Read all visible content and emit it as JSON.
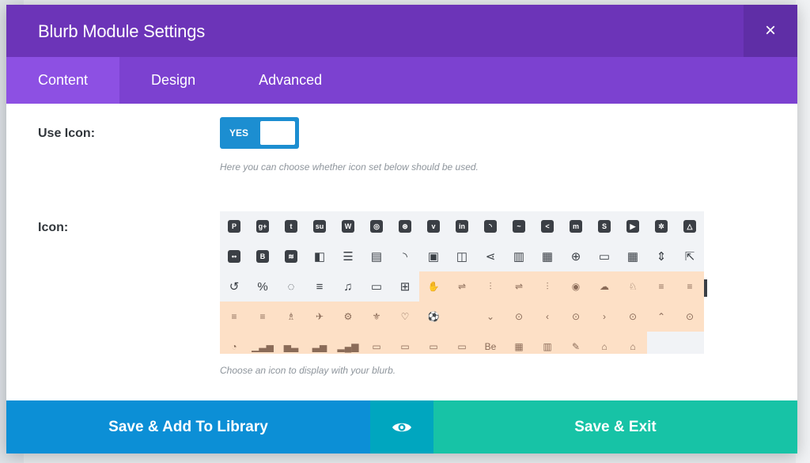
{
  "modal": {
    "title": "Blurb Module Settings",
    "close_glyph": "×",
    "tabs": [
      {
        "label": "Content",
        "active": true
      },
      {
        "label": "Design",
        "active": false
      },
      {
        "label": "Advanced",
        "active": false
      }
    ]
  },
  "use_icon": {
    "label": "Use Icon:",
    "toggle_text": "YES",
    "toggle_on": true,
    "description": "Here you can choose whether icon set below should be used."
  },
  "icon": {
    "label": "Icon:",
    "description": "Choose an icon to display with your blurb.",
    "rows": [
      [
        "pinterest-icon",
        "google-plus-icon",
        "tumblr-icon",
        "stumbleupon-icon",
        "wordpress-icon",
        "instagram-icon",
        "dribbble-icon",
        "vimeo-icon",
        "linkedin-icon",
        "rss-icon",
        "deviantart-icon",
        "share-icon",
        "myspace-icon",
        "skype-icon",
        "youtube-icon",
        "picassa-icon",
        "google-drive-icon"
      ],
      [
        "flickr-icon",
        "blogger-icon",
        "spotify-icon",
        "delicious-icon",
        "list-icon",
        "news-icon",
        "feed-icon",
        "gallery-icon",
        "columns-icon",
        "share-alt-icon",
        "book-icon",
        "table-icon",
        "hash-icon",
        "browser-icon",
        "grid-icon",
        "resize-icon",
        "cursor-icon"
      ],
      [
        "history-icon",
        "percent-icon",
        "chat-icon",
        "align-left-icon",
        "music-icon",
        "laptop-icon",
        "gift-icon",
        "hand-icon",
        "sliders-icon",
        "sliders-alt-icon",
        "equalizer-icon",
        "sliders-v-icon",
        "equalizer-v-icon",
        "cloud-icon",
        "bell-icon",
        "bug-icon",
        "align-center-icon"
      ],
      [
        "align-left-alt-icon",
        "align-right-icon",
        "stamp-icon",
        "plane-icon",
        "chip-icon",
        "badge-icon",
        "heart-icon",
        "basketball-icon",
        "apple-icon",
        "chevron-down-icon",
        "circle-chevron-down-icon",
        "chevron-left-icon",
        "circle-chevron-left-icon",
        "chevron-right-icon",
        "circle-chevron-right-icon",
        "chevron-up-icon",
        "circle-chevron-up-icon"
      ],
      [
        "pie-icon",
        "bar-chart-icon",
        "bar-chart-alt-icon",
        "bar-chart-down-icon",
        "bar-chart-up-icon",
        "battery-full-icon",
        "battery-mid-icon",
        "battery-low-icon",
        "battery-empty-icon",
        "behance-icon",
        "calendar-icon",
        "building-icon",
        "pen-icon",
        "shop-icon",
        "bank-icon"
      ]
    ],
    "glyphs": {
      "pinterest-icon": "P",
      "google-plus-icon": "g+",
      "tumblr-icon": "t",
      "stumbleupon-icon": "su",
      "wordpress-icon": "W",
      "instagram-icon": "◎",
      "dribbble-icon": "⊛",
      "vimeo-icon": "v",
      "linkedin-icon": "in",
      "rss-icon": "◝",
      "deviantart-icon": "~",
      "share-icon": "<",
      "myspace-icon": "m",
      "skype-icon": "S",
      "youtube-icon": "▶",
      "picassa-icon": "✲",
      "google-drive-icon": "△",
      "flickr-icon": "••",
      "blogger-icon": "B",
      "spotify-icon": "≋",
      "delicious-icon": "◧",
      "list-icon": "☰",
      "news-icon": "▤",
      "feed-icon": "◝",
      "gallery-icon": "▣",
      "columns-icon": "◫",
      "share-alt-icon": "⋖",
      "book-icon": "▥",
      "table-icon": "▦",
      "hash-icon": "⊕",
      "browser-icon": "▭",
      "grid-icon": "▦",
      "resize-icon": "⇕",
      "cursor-icon": "⇱",
      "history-icon": "↺",
      "percent-icon": "%",
      "chat-icon": "◌",
      "align-left-icon": "≡",
      "music-icon": "♫",
      "laptop-icon": "▭",
      "gift-icon": "⊞",
      "hand-icon": "✋",
      "sliders-icon": "⇌",
      "sliders-alt-icon": "⫶",
      "equalizer-icon": "⇌",
      "sliders-v-icon": "⫶",
      "equalizer-v-icon": "◉",
      "cloud-icon": "☁",
      "bell-icon": "♘",
      "bug-icon": "≡",
      "align-center-icon": "≡",
      "align-left-alt-icon": "≡",
      "align-right-icon": "≡",
      "stamp-icon": "♗",
      "plane-icon": "✈",
      "chip-icon": "⚙",
      "badge-icon": "⚜",
      "heart-icon": "♡",
      "basketball-icon": "⚽",
      "apple-icon": "",
      "chevron-down-icon": "⌄",
      "circle-chevron-down-icon": "⊙",
      "chevron-left-icon": "‹",
      "circle-chevron-left-icon": "⊙",
      "chevron-right-icon": "›",
      "circle-chevron-right-icon": "⊙",
      "chevron-up-icon": "⌃",
      "circle-chevron-up-icon": "⊙",
      "pie-icon": "◔",
      "bar-chart-icon": "▁▃▅",
      "bar-chart-alt-icon": "▅▃",
      "bar-chart-down-icon": "▃▅",
      "bar-chart-up-icon": "▂▄▆",
      "battery-full-icon": "▭",
      "battery-mid-icon": "▭",
      "battery-low-icon": "▭",
      "battery-empty-icon": "▭",
      "behance-icon": "Be",
      "calendar-icon": "▦",
      "building-icon": "▥",
      "pen-icon": "✎",
      "shop-icon": "⌂",
      "bank-icon": "⌂"
    },
    "highlighted_start": {
      "row": 2,
      "col": 7
    }
  },
  "footer": {
    "library_label": "Save & Add To Library",
    "preview_icon": "eye-icon",
    "save_label": "Save & Exit"
  },
  "colors": {
    "header": "#6c34b8",
    "tabs": "#7c41d0",
    "tab_active": "#8d50e3",
    "toggle": "#1c8ed1",
    "library_button": "#0c8fd6",
    "preview_button": "#00a6bf",
    "save_button": "#17c3a6",
    "icon_highlight": "#fde0c6"
  }
}
